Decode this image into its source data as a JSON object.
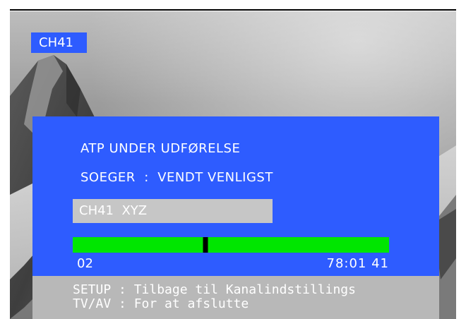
{
  "channel_badge": "CH41",
  "atp": {
    "status": "ATP UNDER UDFØRELSE",
    "search_line": "SOEGER  :  VENDT VENLIGST",
    "current_channel": "CH41  XYZ",
    "progress": {
      "fraction": 0.42,
      "left_label": "02",
      "right_label": "78:01 41"
    }
  },
  "footer": {
    "setup_hint": "SETUP : Tilbage til Kanalindstillings",
    "tvav_hint": "TV/AV : For at afslutte"
  },
  "colors": {
    "panel_blue": "#2e5cff",
    "progress_green": "#00e600",
    "footer_gray": "#b8b8b8"
  }
}
